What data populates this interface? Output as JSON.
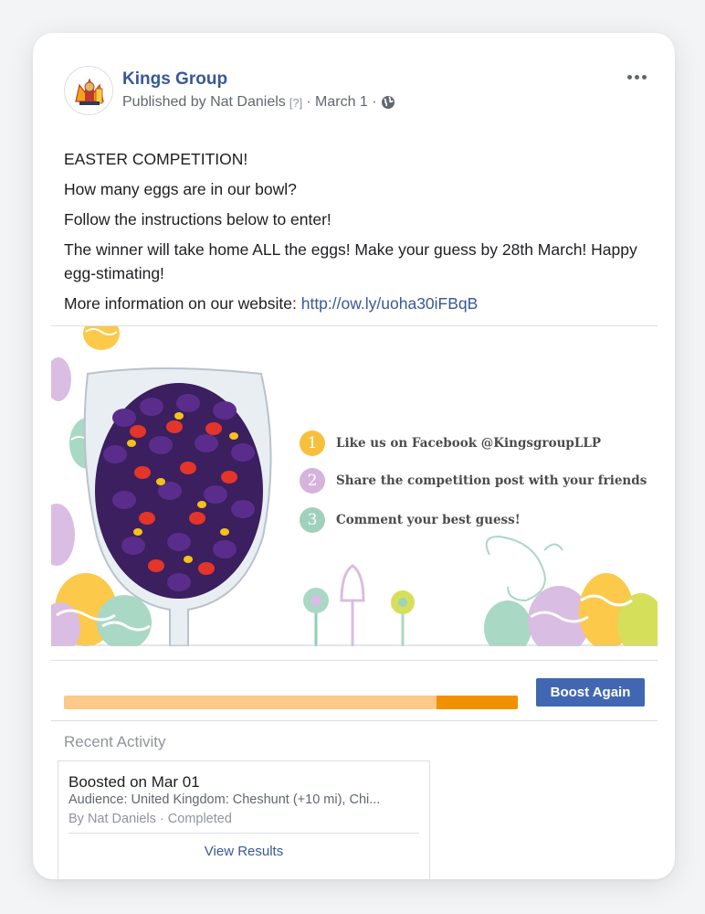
{
  "post": {
    "page_name": "Kings Group",
    "published_by": "Published by Nat Daniels",
    "help_marker": "[?]",
    "date": "· March 1 ·",
    "text_lines": [
      "EASTER COMPETITION!",
      "How many eggs are in our bowl?",
      "Follow the instructions below to enter!",
      "The winner will take home ALL the eggs! Make your guess by 28th March! Happy egg-stimating!"
    ],
    "more_info_text": "More information on our website: ",
    "more_info_link": "http://ow.ly/uoha30iFBqB"
  },
  "image": {
    "steps": [
      {
        "num": "1",
        "text": "Like us on Facebook @KingsgroupLLP",
        "color": "#f6c03e"
      },
      {
        "num": "2",
        "text": "Share the competition post with your friends",
        "color": "#d5b3dc"
      },
      {
        "num": "3",
        "text": "Comment your best guess!",
        "color": "#9fd1bd"
      }
    ]
  },
  "boost": {
    "button_label": "Boost Again",
    "progress": 0.18,
    "track_color": "#fcc98a",
    "fill_color": "#f29100"
  },
  "recent_activity": {
    "title": "Recent Activity",
    "item": {
      "title": "Boosted on Mar 01",
      "audience": "Audience: United Kingdom: Cheshunt (+10 mi), Chi...",
      "by": "By Nat Daniels · Completed",
      "view_results": "View Results"
    }
  },
  "icons": {
    "globe": "globe-icon",
    "more": "more-options-icon"
  },
  "colors": {
    "link": "#385898",
    "button": "#4267b2"
  }
}
